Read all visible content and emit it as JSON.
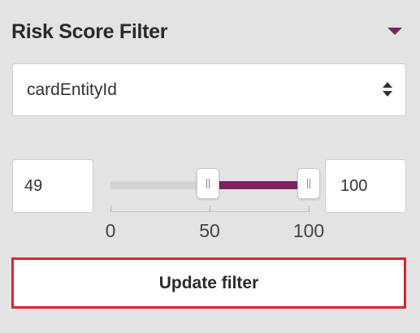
{
  "panel": {
    "title": "Risk Score Filter",
    "collapse_icon": "caret-down-icon"
  },
  "select": {
    "value": "cardEntityId",
    "icon": "sort-arrows-icon"
  },
  "range": {
    "min_value": "49",
    "max_value": "100",
    "scale_min": 0,
    "scale_max": 100,
    "selected_min": 49,
    "selected_max": 100,
    "ticks": [
      {
        "value": 0,
        "label": "0"
      },
      {
        "value": 50,
        "label": "50"
      },
      {
        "value": 100,
        "label": "100"
      }
    ],
    "fill_color": "#7a2461",
    "track_color": "#d4d4d4"
  },
  "actions": {
    "update_label": "Update filter",
    "highlight_color": "#e0242f"
  }
}
